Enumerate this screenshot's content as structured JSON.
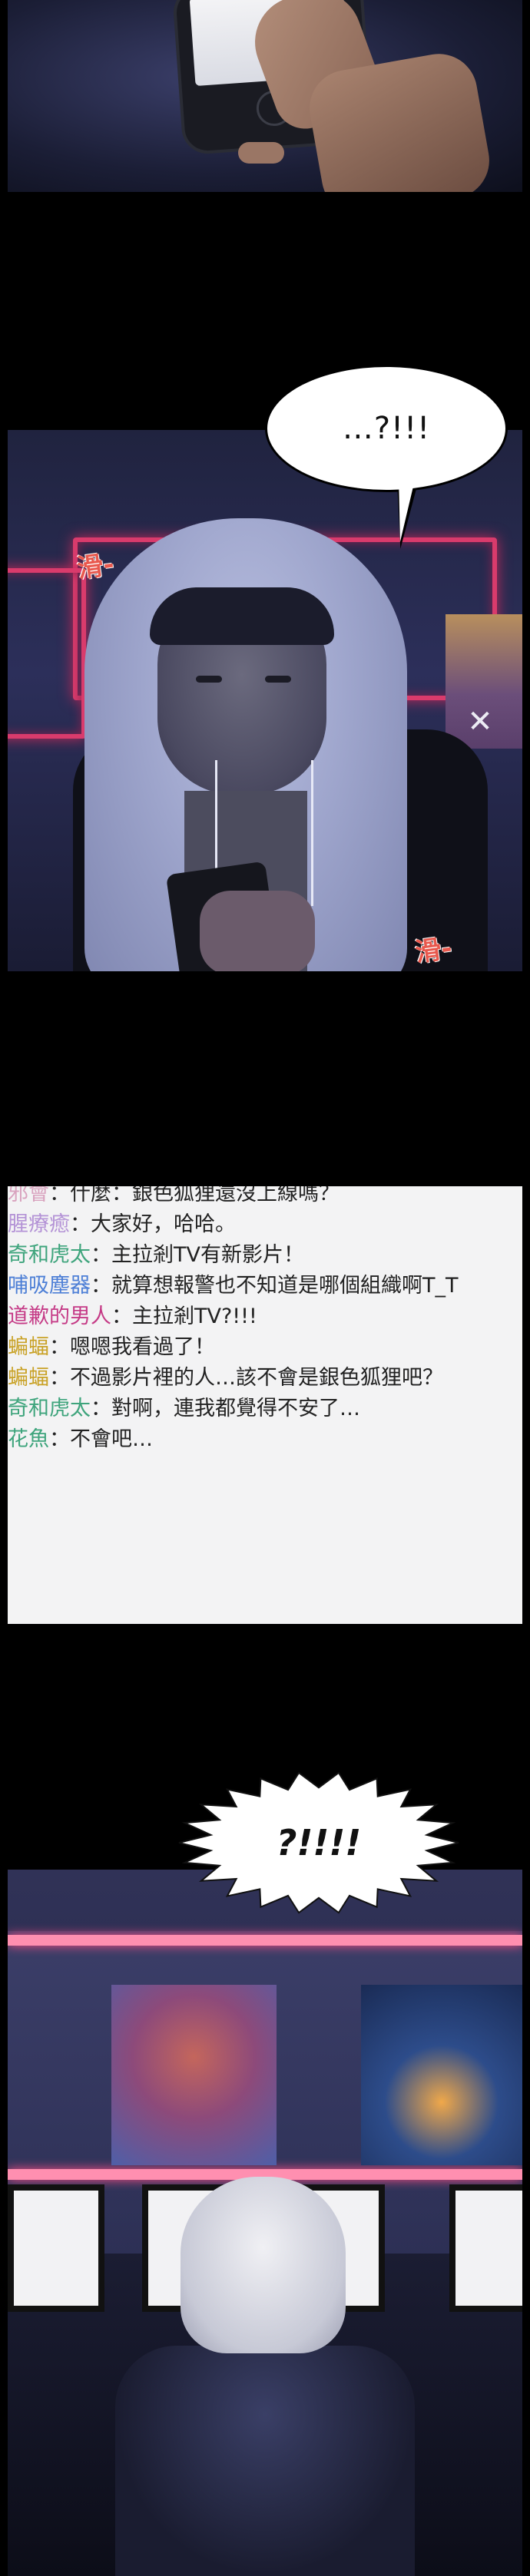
{
  "panel2": {
    "speech": "…?!!!",
    "sfx_left": "滑-",
    "sfx_right": "滑-"
  },
  "chat": {
    "lines": [
      {
        "user": "邪會",
        "sep": "：",
        "text": "什麼：銀色狐狸還沒上線嗎？",
        "color": "#d9a3bf"
      },
      {
        "user": "腥療癒",
        "sep": "：",
        "text": "大家好，哈哈。",
        "color": "#b493d6"
      },
      {
        "user": "奇和虎太",
        "sep": "：",
        "text": "主拉剎TV有新影片！",
        "color": "#3ea47c"
      },
      {
        "user": "哺吸塵器",
        "sep": "：",
        "text": "就算想報警也不知道是哪個組織啊T_T",
        "color": "#4d7fd6"
      },
      {
        "user": "道歉的男人",
        "sep": "：",
        "text": "主拉剎TV?!!!",
        "color": "#c53a86"
      },
      {
        "user": "蝙蝠",
        "sep": "：",
        "text": "嗯嗯我看過了！",
        "color": "#c9a227"
      },
      {
        "user": "蝙蝠",
        "sep": "：",
        "text": "不過影片裡的人…該不會是銀色狐狸吧？",
        "color": "#c9a227"
      },
      {
        "user": "奇和虎太",
        "sep": "：",
        "text": "對啊，連我都覺得不安了…",
        "color": "#3ea47c"
      },
      {
        "user": "花魚",
        "sep": "：",
        "text": "不會吧…",
        "color": "#3ea47c"
      }
    ]
  },
  "panel4": {
    "shout": "?!!!!"
  },
  "colors": {
    "neon_pink": "#d93b6c",
    "sfx_red": "#e8584d"
  }
}
